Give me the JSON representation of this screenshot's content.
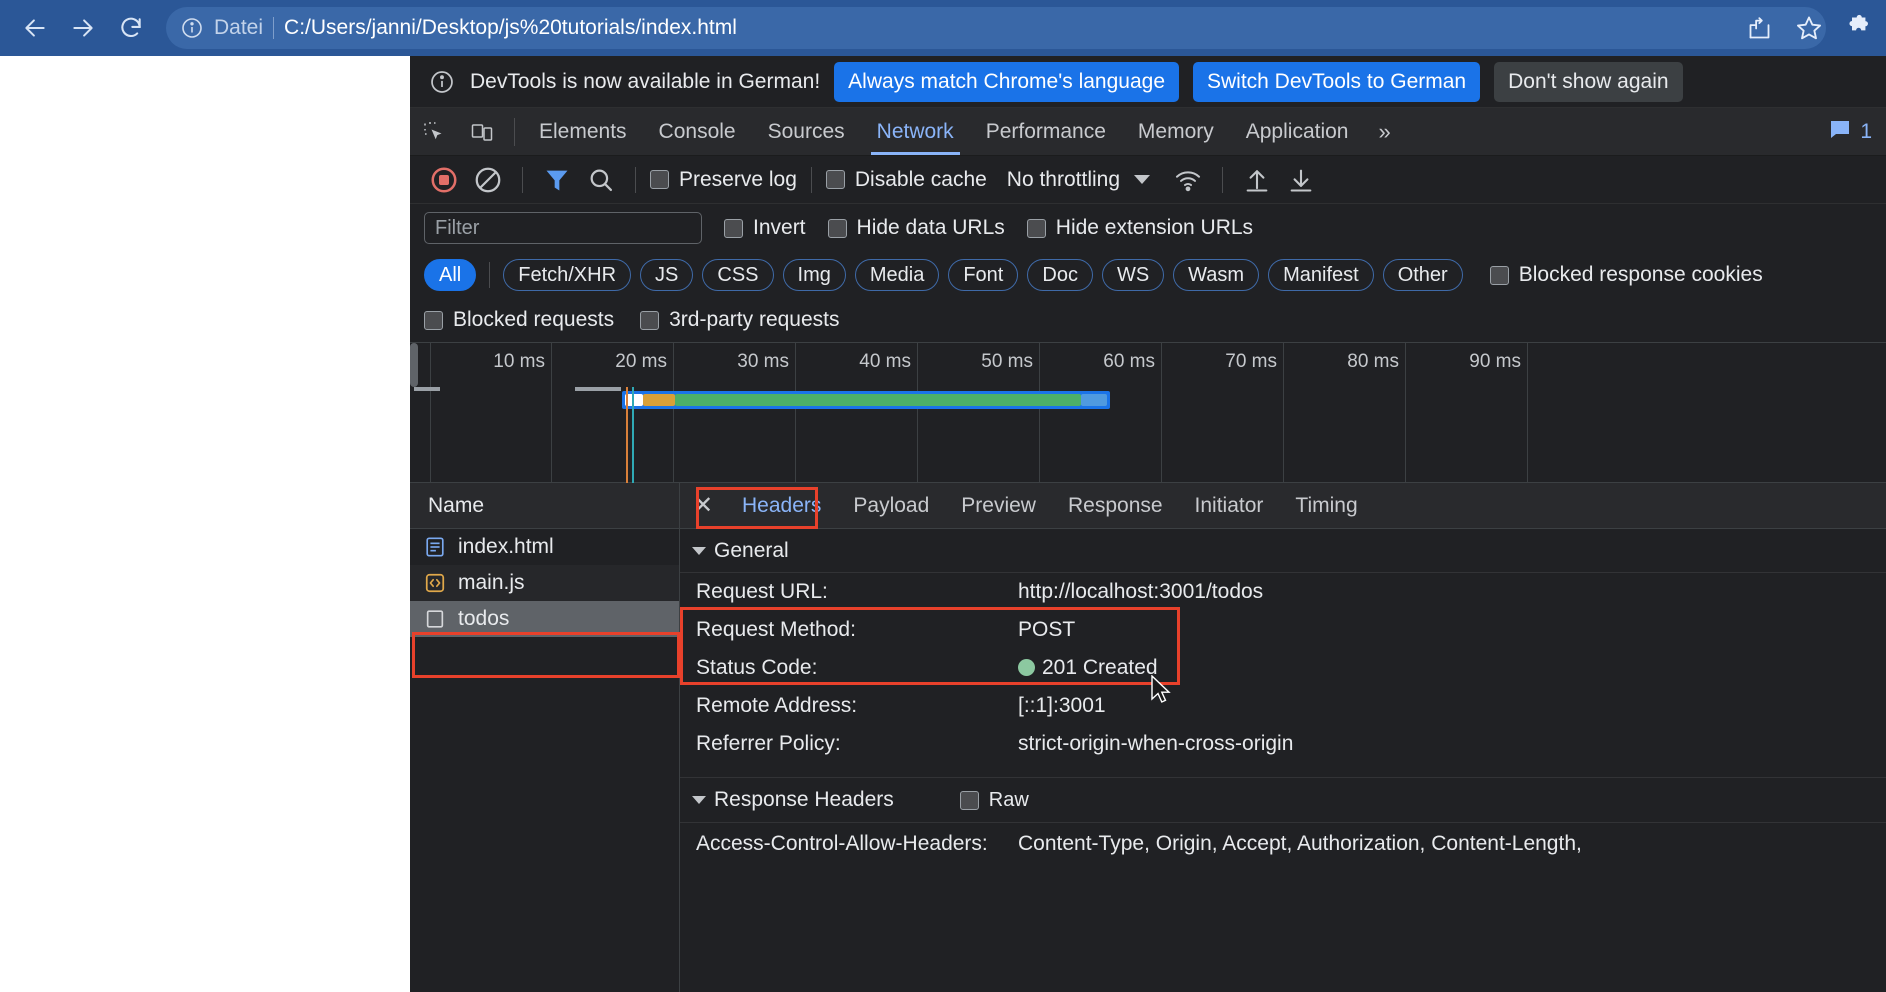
{
  "browser": {
    "back_icon": "arrow-left-icon",
    "forward_icon": "arrow-right-icon",
    "reload_icon": "reload-icon",
    "info_icon": "info-circle-icon",
    "scheme_label": "Datei",
    "url": "C:/Users/janni/Desktop/js%20tutorials/index.html",
    "share_icon": "share-icon",
    "bookmark_icon": "star-icon",
    "extensions_icon": "puzzle-icon",
    "accent": "#2b5797"
  },
  "devtools": {
    "notification": {
      "icon": "info-circle-icon",
      "message": "DevTools is now available in German!",
      "primary_button": "Always match Chrome's language",
      "secondary_button": "Switch DevTools to German",
      "dismiss_button": "Don't show again"
    },
    "tools": {
      "inspect_icon": "inspect-element-icon",
      "device_icon": "device-toolbar-icon",
      "tabs": [
        {
          "label": "Elements",
          "active": false
        },
        {
          "label": "Console",
          "active": false
        },
        {
          "label": "Sources",
          "active": false
        },
        {
          "label": "Network",
          "active": true
        },
        {
          "label": "Performance",
          "active": false
        },
        {
          "label": "Memory",
          "active": false
        },
        {
          "label": "Application",
          "active": false
        }
      ],
      "overflow_label": "»",
      "message_icon": "message-bubble-icon",
      "message_count": "1"
    },
    "network_toolbar": {
      "record_icon": "record-stop-icon",
      "clear_icon": "clear-icon",
      "filter_icon": "funnel-icon",
      "search_icon": "search-icon",
      "preserve_log_label": "Preserve log",
      "disable_cache_label": "Disable cache",
      "throttling_value": "No throttling",
      "throttle_caret_icon": "chevron-down-icon",
      "wifi_icon": "network-conditions-icon",
      "import_icon": "upload-har-icon",
      "export_icon": "download-har-icon"
    },
    "filter_row": {
      "placeholder": "Filter",
      "value": "",
      "invert_label": "Invert",
      "hide_data_urls_label": "Hide data URLs",
      "hide_extension_urls_label": "Hide extension URLs"
    },
    "type_chips": [
      {
        "label": "All",
        "active": true
      },
      {
        "label": "Fetch/XHR",
        "active": false
      },
      {
        "label": "JS",
        "active": false
      },
      {
        "label": "CSS",
        "active": false
      },
      {
        "label": "Img",
        "active": false
      },
      {
        "label": "Media",
        "active": false
      },
      {
        "label": "Font",
        "active": false
      },
      {
        "label": "Doc",
        "active": false
      },
      {
        "label": "WS",
        "active": false
      },
      {
        "label": "Wasm",
        "active": false
      },
      {
        "label": "Manifest",
        "active": false
      },
      {
        "label": "Other",
        "active": false
      }
    ],
    "blocked_cookies_label": "Blocked response cookies",
    "blocked_requests_label": "Blocked requests",
    "third_party_label": "3rd-party requests",
    "timeline": {
      "ticks": [
        "10 ms",
        "20 ms",
        "30 ms",
        "40 ms",
        "50 ms",
        "60 ms",
        "70 ms",
        "80 ms",
        "90 ms"
      ],
      "bar_colors": {
        "queueing": "#ffffff",
        "stalled": "#d9a038",
        "waiting": "#4caf68",
        "download": "#4f9ae0",
        "border": "#1a73e8"
      }
    },
    "requests": {
      "column_header": "Name",
      "rows": [
        {
          "name": "index.html",
          "icon": "document-icon",
          "selected": false
        },
        {
          "name": "main.js",
          "icon": "script-icon",
          "selected": false
        },
        {
          "name": "todos",
          "icon": "generic-file-icon",
          "selected": true
        }
      ]
    },
    "details": {
      "close_icon": "close-icon",
      "tabs": [
        {
          "label": "Headers",
          "active": true
        },
        {
          "label": "Payload",
          "active": false
        },
        {
          "label": "Preview",
          "active": false
        },
        {
          "label": "Response",
          "active": false
        },
        {
          "label": "Initiator",
          "active": false
        },
        {
          "label": "Timing",
          "active": false
        }
      ],
      "general": {
        "title": "General",
        "rows": [
          {
            "key": "Request URL:",
            "value": "http://localhost:3001/todos",
            "dot": false
          },
          {
            "key": "Request Method:",
            "value": "POST",
            "dot": false
          },
          {
            "key": "Status Code:",
            "value": "201 Created",
            "dot": true
          },
          {
            "key": "Remote Address:",
            "value": "[::1]:3001",
            "dot": false
          },
          {
            "key": "Referrer Policy:",
            "value": "strict-origin-when-cross-origin",
            "dot": false
          }
        ]
      },
      "response_headers": {
        "title": "Response Headers",
        "raw_label": "Raw",
        "rows": [
          {
            "key": "Access-Control-Allow-Headers:",
            "value": "Content-Type, Origin, Accept, Authorization, Content-Length,"
          }
        ]
      }
    },
    "highlight_color": "#e8412b"
  }
}
